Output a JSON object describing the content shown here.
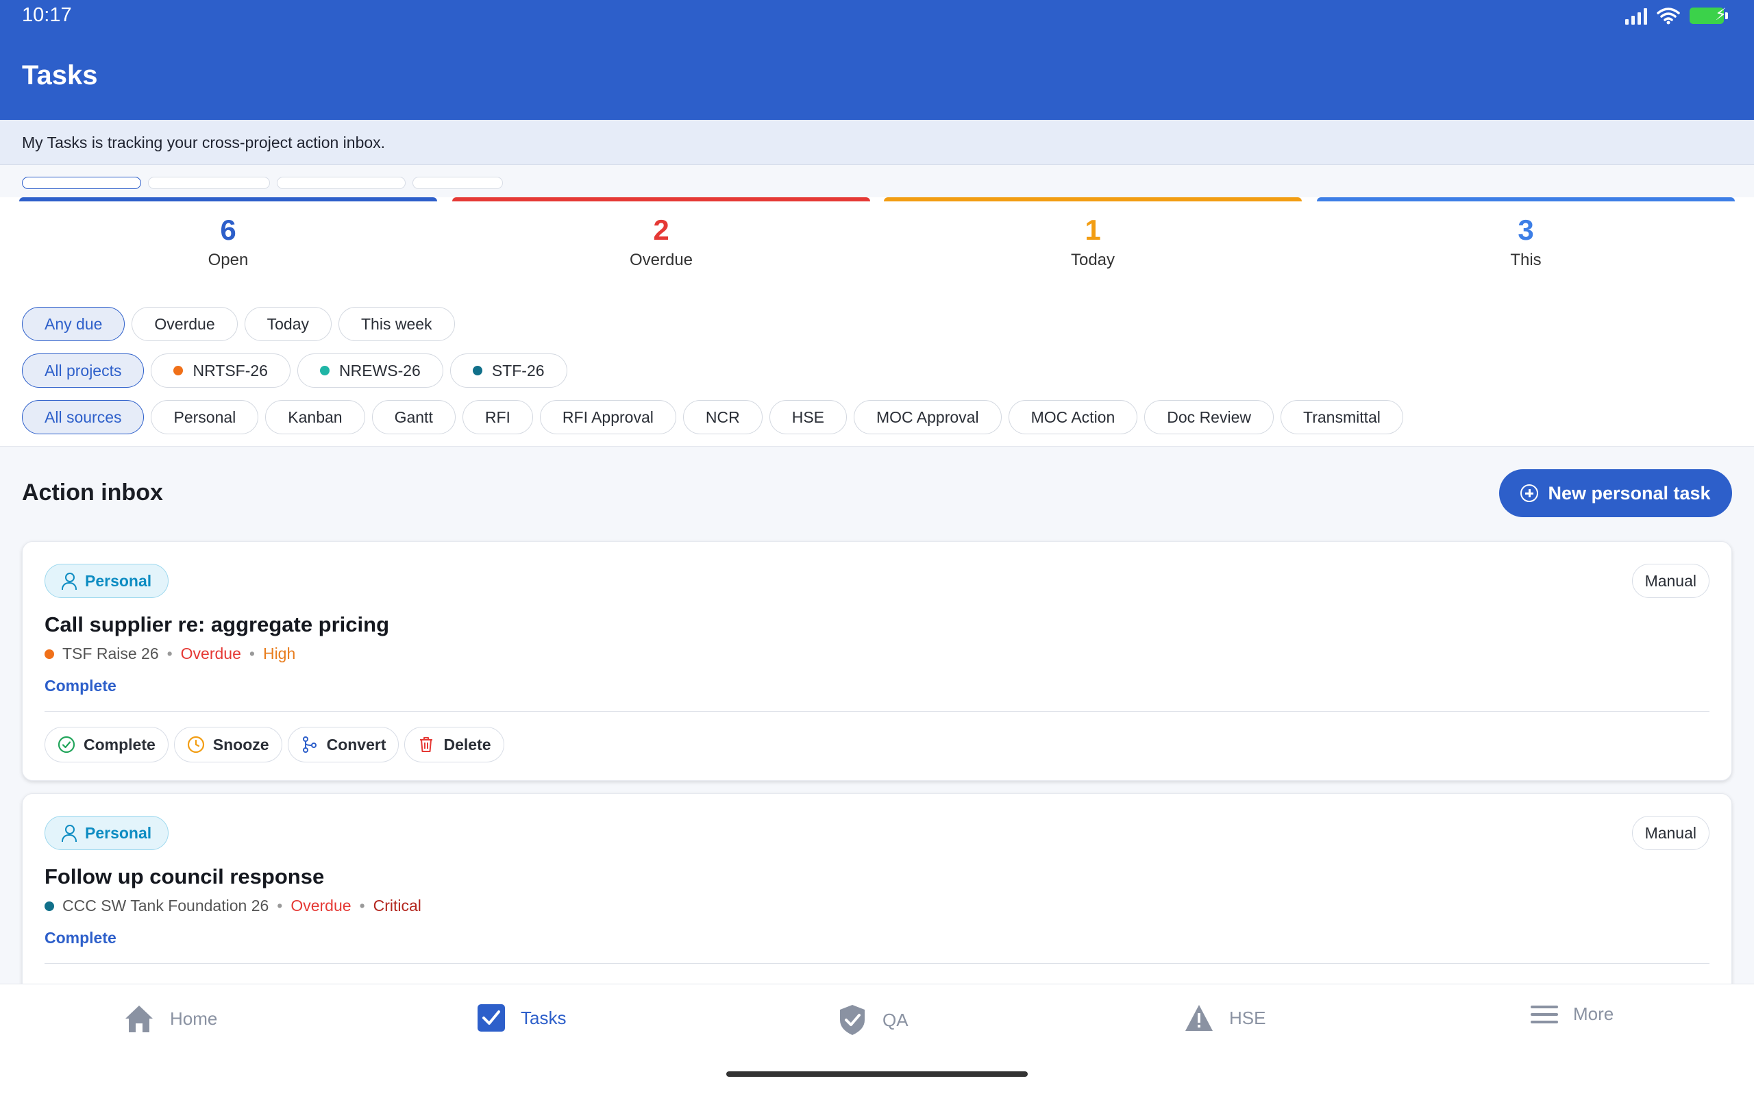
{
  "status": {
    "time": "10:17"
  },
  "header": {
    "title": "Tasks"
  },
  "banner": {
    "text": "My Tasks is tracking your cross-project action inbox."
  },
  "stats": [
    {
      "value": "6",
      "label": "Open",
      "color": "#2d5fca"
    },
    {
      "value": "2",
      "label": "Overdue",
      "color": "#e53935"
    },
    {
      "value": "1",
      "label": "Today",
      "color": "#f29d12"
    },
    {
      "value": "3",
      "label": "This",
      "color": "#3d7ee6"
    }
  ],
  "filters": {
    "due": [
      "Any due",
      "Overdue",
      "Today",
      "This week"
    ],
    "projects": [
      {
        "label": "All projects"
      },
      {
        "label": "NRTSF-26",
        "color": "#f07019"
      },
      {
        "label": "NREWS-26",
        "color": "#1fb5a6"
      },
      {
        "label": "STF-26",
        "color": "#11708a"
      }
    ],
    "sources": [
      "All sources",
      "Personal",
      "Kanban",
      "Gantt",
      "RFI",
      "RFI Approval",
      "NCR",
      "HSE",
      "MOC Approval",
      "MOC Action",
      "Doc Review",
      "Transmittal"
    ]
  },
  "inbox": {
    "title": "Action inbox",
    "new_button": "New personal task",
    "tasks": [
      {
        "type": "Personal",
        "origin": "Manual",
        "title": "Call supplier re: aggregate pricing",
        "project": "TSF Raise 26",
        "project_color": "#f07019",
        "status": "Overdue",
        "priority": "High",
        "priority_color": "#e87d1e",
        "link": "Complete"
      },
      {
        "type": "Personal",
        "origin": "Manual",
        "title": "Follow up council response",
        "project": "CCC SW Tank Foundation 26",
        "project_color": "#11708a",
        "status": "Overdue",
        "priority": "Critical",
        "priority_color": "#b3261e",
        "link": "Complete"
      }
    ],
    "actions": {
      "complete": "Complete",
      "snooze": "Snooze",
      "convert": "Convert",
      "delete": "Delete"
    }
  },
  "nav": {
    "home": "Home",
    "tasks": "Tasks",
    "qa": "QA",
    "hse": "HSE",
    "more": "More"
  }
}
